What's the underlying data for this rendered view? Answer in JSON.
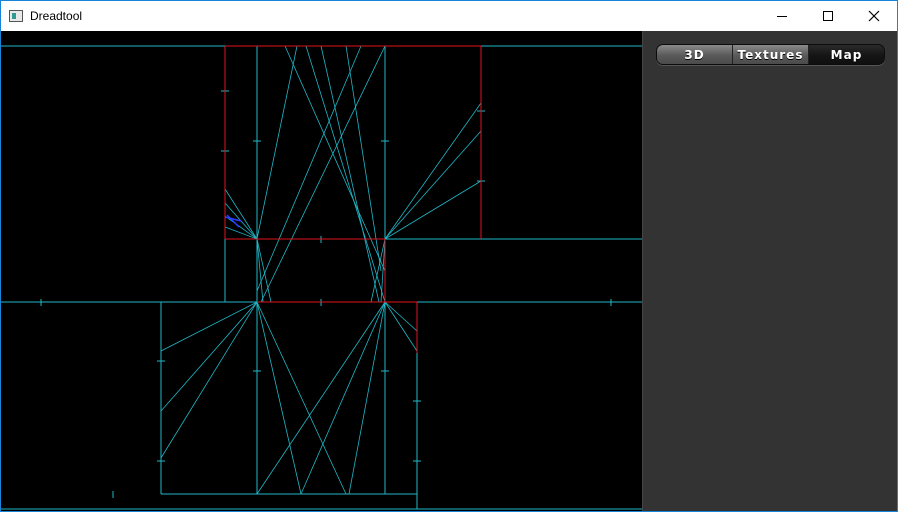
{
  "window": {
    "title": "Dreadtool",
    "controls": {
      "minimize_icon": "minimize-icon",
      "maximize_icon": "maximize-icon",
      "close_icon": "close-icon"
    }
  },
  "side_panel": {
    "tabs": [
      {
        "label": "3D",
        "active": false
      },
      {
        "label": "Textures",
        "active": false
      },
      {
        "label": "Map",
        "active": true
      }
    ]
  },
  "colors": {
    "wall": "#e0141e",
    "portal": "#1fb8c8",
    "selected": "#2a3cff",
    "background": "#000000",
    "panel": "#333333"
  }
}
